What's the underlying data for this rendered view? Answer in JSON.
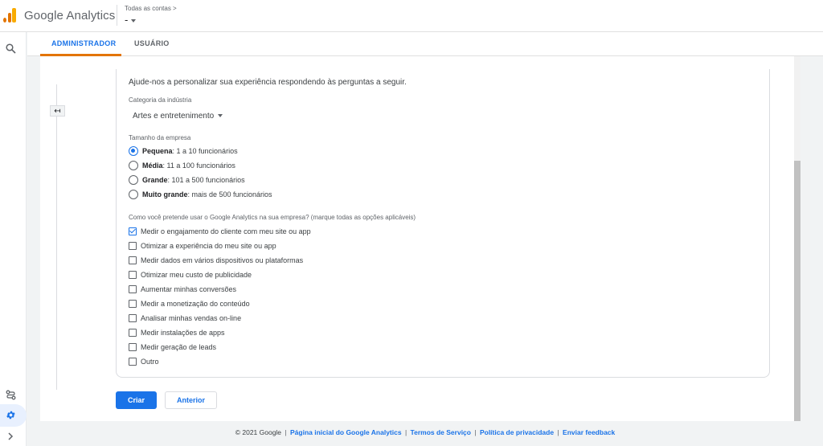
{
  "header": {
    "brand": "Google Analytics",
    "account_breadcrumb": "Todas as contas >",
    "account_selected": "-"
  },
  "tabs": [
    {
      "label": "ADMINISTRADOR"
    },
    {
      "label": "USUÁRIO"
    }
  ],
  "form": {
    "intro": "Ajude-nos a personalizar sua experiência respondendo às perguntas a seguir.",
    "industry_label": "Categoria da indústria",
    "industry_value": "Artes e entretenimento",
    "size_label": "Tamanho da empresa",
    "sizes": [
      {
        "bold": "Pequena",
        "rest": ": 1 a 10 funcionários",
        "selected": true
      },
      {
        "bold": "Média",
        "rest": ": 11 a 100 funcionários",
        "selected": false
      },
      {
        "bold": "Grande",
        "rest": ": 101 a 500 funcionários",
        "selected": false
      },
      {
        "bold": "Muito grande",
        "rest": ": mais de 500 funcionários",
        "selected": false
      }
    ],
    "usage_label": "Como você pretende usar o Google Analytics na sua empresa? (marque todas as opções aplicáveis)",
    "usages": [
      {
        "label": "Medir o engajamento do cliente com meu site ou app",
        "checked": true
      },
      {
        "label": "Otimizar a experiência do meu site ou app",
        "checked": false
      },
      {
        "label": "Medir dados em vários dispositivos ou plataformas",
        "checked": false
      },
      {
        "label": "Otimizar meu custo de publicidade",
        "checked": false
      },
      {
        "label": "Aumentar minhas conversões",
        "checked": false
      },
      {
        "label": "Medir a monetização do conteúdo",
        "checked": false
      },
      {
        "label": "Analisar minhas vendas on-line",
        "checked": false
      },
      {
        "label": "Medir instalações de apps",
        "checked": false
      },
      {
        "label": "Medir geração de leads",
        "checked": false
      },
      {
        "label": "Outro",
        "checked": false
      }
    ],
    "create_label": "Criar",
    "back_label": "Anterior"
  },
  "footer": {
    "copyright": "© 2021 Google",
    "links": [
      "Página inicial do Google Analytics",
      "Termos de Serviço",
      "Política de privacidade",
      "Enviar feedback"
    ]
  },
  "colors": {
    "accent": "#1a73e8",
    "brand_orange": "#e37400"
  },
  "icons": {
    "search": "search-icon",
    "admin": "gear-icon",
    "back": "back-arrow-icon",
    "routes": "routes-icon",
    "expand": "chevron-right-icon"
  }
}
